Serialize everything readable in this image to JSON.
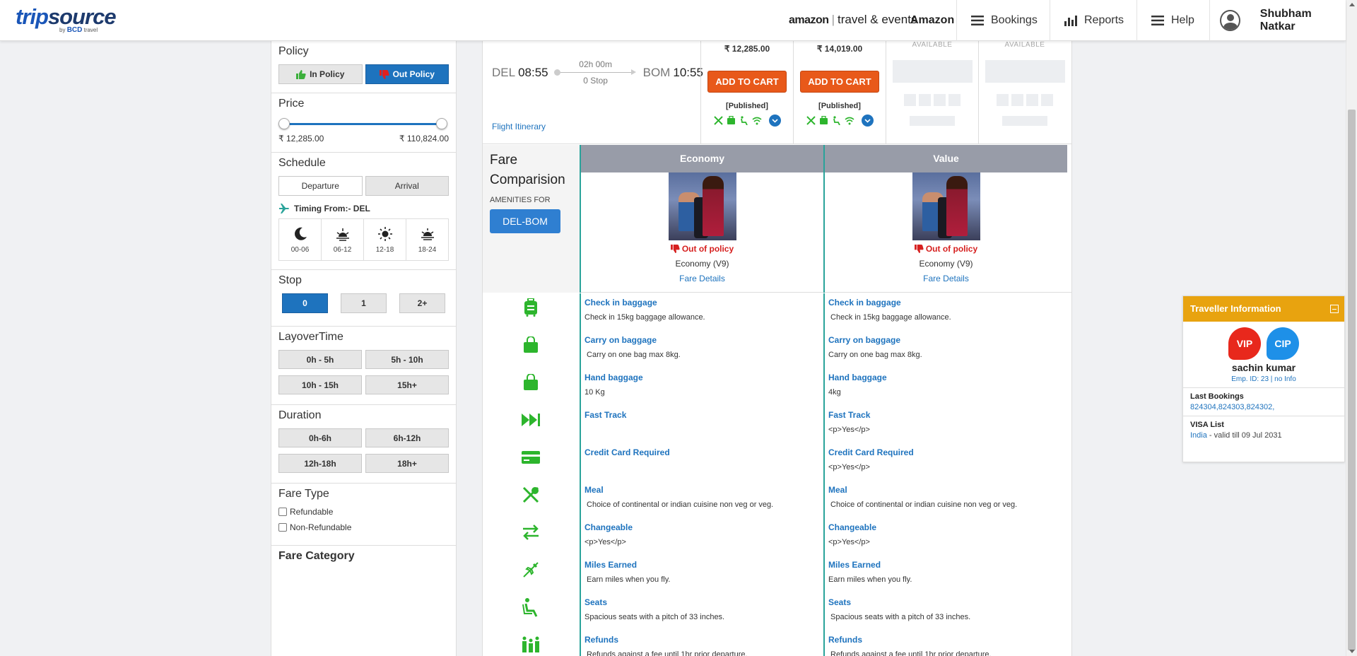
{
  "header": {
    "logo_a": "trip",
    "logo_b": "source",
    "logo_by": "by",
    "logo_bcd": "BCD",
    "logo_travel": "travel",
    "amazon_brand": "amazon",
    "amazon_section": "travel & events",
    "amazon_link": "Amazon",
    "nav": [
      {
        "label": "Bookings",
        "icon": "menu-icon"
      },
      {
        "label": "Reports",
        "icon": "bar-chart-icon"
      },
      {
        "label": "Help",
        "icon": "menu-icon"
      }
    ],
    "user_name": "Shubham Natkar"
  },
  "filters": {
    "policy": {
      "title": "Policy",
      "in_label": "In Policy",
      "out_label": "Out Policy",
      "selected": "Out Policy"
    },
    "price": {
      "title": "Price",
      "min": "₹ 12,285.00",
      "max": "₹ 110,824.00"
    },
    "schedule": {
      "title": "Schedule",
      "departure": "Departure",
      "arrival": "Arrival",
      "timing_label": "Timing From:- DEL",
      "slots": [
        "00-06",
        "06-12",
        "12-18",
        "18-24"
      ]
    },
    "stop": {
      "title": "Stop",
      "options": [
        "0",
        "1",
        "2+"
      ],
      "selected": "0"
    },
    "layover": {
      "title": "LayoverTime",
      "options": [
        "0h - 5h",
        "5h - 10h",
        "10h - 15h",
        "15h+"
      ]
    },
    "duration": {
      "title": "Duration",
      "options": [
        "0h-6h",
        "6h-12h",
        "12h-18h",
        "18h+"
      ]
    },
    "fare_type": {
      "title": "Fare Type",
      "options": [
        "Refundable",
        "Non-Refundable"
      ]
    },
    "fare_category": {
      "title": "Fare Category"
    }
  },
  "flight": {
    "from_code": "DEL",
    "dep_time": "08:55",
    "duration": "02h 00m",
    "stops": "0 Stop",
    "to_code": "BOM",
    "arr_time": "10:55",
    "itinerary_link": "Flight Itinerary",
    "fares": [
      {
        "price": "₹ 12,285.00",
        "cta": "ADD TO CART",
        "type": "[Published]"
      },
      {
        "price": "₹ 14,019.00",
        "cta": "ADD TO CART",
        "type": "[Published]"
      }
    ],
    "unavailable_label": "AVAILABLE"
  },
  "comparison": {
    "title": "Fare Comparision",
    "amenities_for": "AMENITIES FOR",
    "route": "DEL-BOM",
    "classes": [
      {
        "name": "Economy",
        "policy": "Out of policy",
        "code": "Economy (V9)",
        "link": "Fare Details"
      },
      {
        "name": "Value",
        "policy": "Out of policy",
        "code": "Economy (V9)",
        "link": "Fare Details"
      }
    ],
    "amenities": [
      {
        "title": "Check in baggage",
        "icon": "luggage-icon",
        "values": [
          "Check in 15kg baggage allowance.",
          " Check in 15kg baggage allowance."
        ]
      },
      {
        "title": "Carry on baggage",
        "icon": "bag-icon",
        "values": [
          " Carry on one bag max 8kg.",
          "Carry on one bag max 8kg."
        ]
      },
      {
        "title": "Hand baggage",
        "icon": "handbag-icon",
        "values": [
          "10 Kg",
          "4kg"
        ]
      },
      {
        "title": "Fast Track",
        "icon": "fast-forward-icon",
        "values": [
          "",
          "<p>Yes</p>"
        ]
      },
      {
        "title": "Credit Card Required",
        "icon": "credit-card-icon",
        "values": [
          "",
          "<p>Yes</p>"
        ]
      },
      {
        "title": "Meal",
        "icon": "meal-icon",
        "values": [
          " Choice of continental or indian cuisine non veg or veg.",
          " Choice of continental or indian cuisine non veg or veg."
        ]
      },
      {
        "title": "Changeable",
        "icon": "swap-icon",
        "values": [
          "<p>Yes</p>",
          "<p>Yes</p>"
        ]
      },
      {
        "title": "Miles Earned",
        "icon": "plane-icon",
        "values": [
          " Earn miles when you fly.",
          "Earn miles when you fly."
        ]
      },
      {
        "title": "Seats",
        "icon": "seat-icon",
        "values": [
          "Spacious seats with a pitch of 33 inches.",
          " Spacious seats with a pitch of 33 inches."
        ]
      },
      {
        "title": "Refunds",
        "icon": "family-icon",
        "values": [
          " Refunds against a fee until 1hr prior departure.",
          " Refunds against a fee until 1hr prior departure."
        ]
      }
    ]
  },
  "traveller": {
    "title": "Traveller Information",
    "badges": [
      "VIP",
      "CIP"
    ],
    "name": "sachin kumar",
    "emp_id": "Emp. ID: 23 | no Info",
    "last_bookings_label": "Last Bookings",
    "last_bookings": "824304,824303,824302,",
    "visa_label": "VISA List",
    "visa_country": "India",
    "visa_valid": " - valid till 09 Jul 2031"
  },
  "colors": {
    "primary": "#1e73be",
    "cta": "#e8591a",
    "amenity_green": "#2db52d",
    "traveller_header": "#e8a30f",
    "out_of_policy": "#d6201f",
    "teal_divider": "#2aa39a"
  }
}
